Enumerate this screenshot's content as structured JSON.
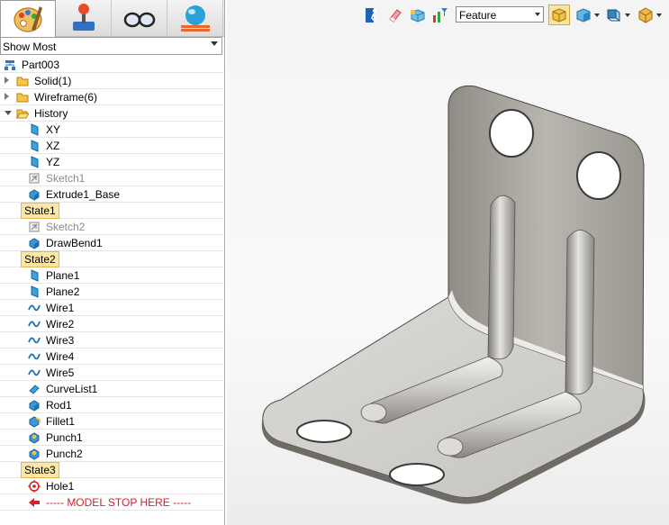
{
  "panel_tabs": [
    {
      "icon": "palette-icon",
      "active": true
    },
    {
      "icon": "joystick-icon",
      "active": false
    },
    {
      "icon": "glasses-icon",
      "active": false
    },
    {
      "icon": "globe-layers-icon",
      "active": false
    }
  ],
  "filter": {
    "value": "Show Most"
  },
  "tree": [
    {
      "label": "Part003",
      "icon": "assembly-icon",
      "level": 0,
      "expander": "none"
    },
    {
      "label": "Solid(1)",
      "icon": "folder-icon",
      "level": 1,
      "expander": "right"
    },
    {
      "label": "Wireframe(6)",
      "icon": "folder-icon",
      "level": 1,
      "expander": "right"
    },
    {
      "label": "History",
      "icon": "folder-open-icon",
      "level": 1,
      "expander": "down"
    },
    {
      "label": "XY",
      "icon": "plane-icon",
      "level": 2
    },
    {
      "label": "XZ",
      "icon": "plane-icon",
      "level": 2
    },
    {
      "label": "YZ",
      "icon": "plane-icon",
      "level": 2
    },
    {
      "label": "Sketch1",
      "icon": "sketch-icon",
      "level": 2,
      "style": "grey"
    },
    {
      "label": "Extrude1_Base",
      "icon": "extrude-icon",
      "level": 2
    },
    {
      "label": "State1",
      "icon": "save-state-icon",
      "level": 2,
      "style": "sel"
    },
    {
      "label": "Sketch2",
      "icon": "sketch-icon",
      "level": 2,
      "style": "grey"
    },
    {
      "label": "DrawBend1",
      "icon": "extrude-icon",
      "level": 2
    },
    {
      "label": "State2",
      "icon": "save-state-icon",
      "level": 2,
      "style": "sel"
    },
    {
      "label": "Plane1",
      "icon": "plane-icon",
      "level": 2
    },
    {
      "label": "Plane2",
      "icon": "plane-icon",
      "level": 2
    },
    {
      "label": "Wire1",
      "icon": "wire-icon",
      "level": 2
    },
    {
      "label": "Wire2",
      "icon": "wire-icon",
      "level": 2
    },
    {
      "label": "Wire3",
      "icon": "wire-icon",
      "level": 2
    },
    {
      "label": "Wire4",
      "icon": "wire-icon",
      "level": 2
    },
    {
      "label": "Wire5",
      "icon": "wire-icon",
      "level": 2
    },
    {
      "label": "CurveList1",
      "icon": "curvelist-icon",
      "level": 2
    },
    {
      "label": "Rod1",
      "icon": "extrude-icon",
      "level": 2
    },
    {
      "label": "Fillet1",
      "icon": "fillet-icon",
      "level": 2
    },
    {
      "label": "Punch1",
      "icon": "punch-icon",
      "level": 2
    },
    {
      "label": "Punch2",
      "icon": "punch-icon",
      "level": 2
    },
    {
      "label": "State3",
      "icon": "save-state-icon",
      "level": 2,
      "style": "sel"
    },
    {
      "label": "Hole1",
      "icon": "hole-icon",
      "level": 2
    },
    {
      "label": "----- MODEL STOP HERE -----",
      "icon": "stop-arrow-icon",
      "level": 2,
      "style": "stop"
    }
  ],
  "toolbar": {
    "feature_select": "Feature",
    "icons": [
      "exit-icon",
      "eraser-icon",
      "cube-select-icon",
      "filter-chart-icon",
      "view-fit-icon",
      "shaded-cube-icon",
      "view-orient-icon",
      "render-mode-icon"
    ]
  },
  "colors": {
    "selection_bg": "#fde7a6",
    "stop_text": "#d4202a",
    "part_metal": "#b7b5b0"
  }
}
